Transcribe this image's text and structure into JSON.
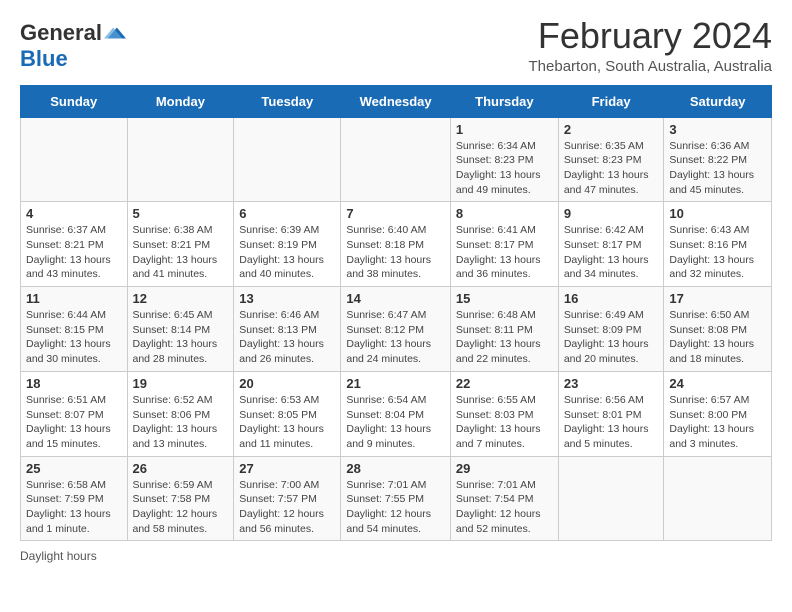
{
  "logo": {
    "general": "General",
    "blue": "Blue"
  },
  "title": "February 2024",
  "subtitle": "Thebarton, South Australia, Australia",
  "days_of_week": [
    "Sunday",
    "Monday",
    "Tuesday",
    "Wednesday",
    "Thursday",
    "Friday",
    "Saturday"
  ],
  "footer": "Daylight hours",
  "weeks": [
    [
      {
        "day": "",
        "info": ""
      },
      {
        "day": "",
        "info": ""
      },
      {
        "day": "",
        "info": ""
      },
      {
        "day": "",
        "info": ""
      },
      {
        "day": "1",
        "info": "Sunrise: 6:34 AM\nSunset: 8:23 PM\nDaylight: 13 hours and 49 minutes."
      },
      {
        "day": "2",
        "info": "Sunrise: 6:35 AM\nSunset: 8:23 PM\nDaylight: 13 hours and 47 minutes."
      },
      {
        "day": "3",
        "info": "Sunrise: 6:36 AM\nSunset: 8:22 PM\nDaylight: 13 hours and 45 minutes."
      }
    ],
    [
      {
        "day": "4",
        "info": "Sunrise: 6:37 AM\nSunset: 8:21 PM\nDaylight: 13 hours and 43 minutes."
      },
      {
        "day": "5",
        "info": "Sunrise: 6:38 AM\nSunset: 8:21 PM\nDaylight: 13 hours and 41 minutes."
      },
      {
        "day": "6",
        "info": "Sunrise: 6:39 AM\nSunset: 8:19 PM\nDaylight: 13 hours and 40 minutes."
      },
      {
        "day": "7",
        "info": "Sunrise: 6:40 AM\nSunset: 8:18 PM\nDaylight: 13 hours and 38 minutes."
      },
      {
        "day": "8",
        "info": "Sunrise: 6:41 AM\nSunset: 8:17 PM\nDaylight: 13 hours and 36 minutes."
      },
      {
        "day": "9",
        "info": "Sunrise: 6:42 AM\nSunset: 8:17 PM\nDaylight: 13 hours and 34 minutes."
      },
      {
        "day": "10",
        "info": "Sunrise: 6:43 AM\nSunset: 8:16 PM\nDaylight: 13 hours and 32 minutes."
      }
    ],
    [
      {
        "day": "11",
        "info": "Sunrise: 6:44 AM\nSunset: 8:15 PM\nDaylight: 13 hours and 30 minutes."
      },
      {
        "day": "12",
        "info": "Sunrise: 6:45 AM\nSunset: 8:14 PM\nDaylight: 13 hours and 28 minutes."
      },
      {
        "day": "13",
        "info": "Sunrise: 6:46 AM\nSunset: 8:13 PM\nDaylight: 13 hours and 26 minutes."
      },
      {
        "day": "14",
        "info": "Sunrise: 6:47 AM\nSunset: 8:12 PM\nDaylight: 13 hours and 24 minutes."
      },
      {
        "day": "15",
        "info": "Sunrise: 6:48 AM\nSunset: 8:11 PM\nDaylight: 13 hours and 22 minutes."
      },
      {
        "day": "16",
        "info": "Sunrise: 6:49 AM\nSunset: 8:09 PM\nDaylight: 13 hours and 20 minutes."
      },
      {
        "day": "17",
        "info": "Sunrise: 6:50 AM\nSunset: 8:08 PM\nDaylight: 13 hours and 18 minutes."
      }
    ],
    [
      {
        "day": "18",
        "info": "Sunrise: 6:51 AM\nSunset: 8:07 PM\nDaylight: 13 hours and 15 minutes."
      },
      {
        "day": "19",
        "info": "Sunrise: 6:52 AM\nSunset: 8:06 PM\nDaylight: 13 hours and 13 minutes."
      },
      {
        "day": "20",
        "info": "Sunrise: 6:53 AM\nSunset: 8:05 PM\nDaylight: 13 hours and 11 minutes."
      },
      {
        "day": "21",
        "info": "Sunrise: 6:54 AM\nSunset: 8:04 PM\nDaylight: 13 hours and 9 minutes."
      },
      {
        "day": "22",
        "info": "Sunrise: 6:55 AM\nSunset: 8:03 PM\nDaylight: 13 hours and 7 minutes."
      },
      {
        "day": "23",
        "info": "Sunrise: 6:56 AM\nSunset: 8:01 PM\nDaylight: 13 hours and 5 minutes."
      },
      {
        "day": "24",
        "info": "Sunrise: 6:57 AM\nSunset: 8:00 PM\nDaylight: 13 hours and 3 minutes."
      }
    ],
    [
      {
        "day": "25",
        "info": "Sunrise: 6:58 AM\nSunset: 7:59 PM\nDaylight: 13 hours and 1 minute."
      },
      {
        "day": "26",
        "info": "Sunrise: 6:59 AM\nSunset: 7:58 PM\nDaylight: 12 hours and 58 minutes."
      },
      {
        "day": "27",
        "info": "Sunrise: 7:00 AM\nSunset: 7:57 PM\nDaylight: 12 hours and 56 minutes."
      },
      {
        "day": "28",
        "info": "Sunrise: 7:01 AM\nSunset: 7:55 PM\nDaylight: 12 hours and 54 minutes."
      },
      {
        "day": "29",
        "info": "Sunrise: 7:01 AM\nSunset: 7:54 PM\nDaylight: 12 hours and 52 minutes."
      },
      {
        "day": "",
        "info": ""
      },
      {
        "day": "",
        "info": ""
      }
    ]
  ]
}
